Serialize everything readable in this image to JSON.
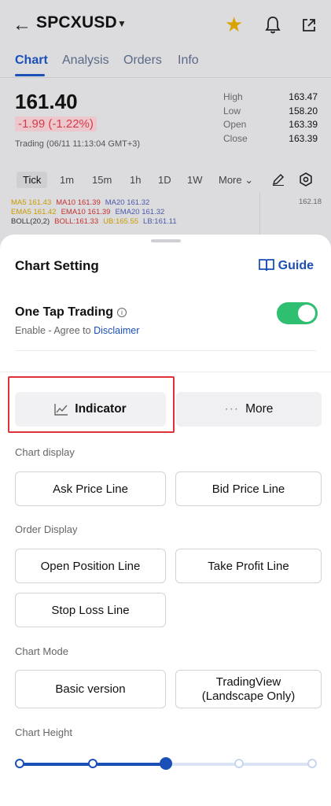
{
  "header": {
    "symbol": "SPCXUSD",
    "back_icon": "arrow-left-icon",
    "favorite_icon": "star-icon",
    "favorite_color": "#d9a400",
    "notification_icon": "bell-icon",
    "share_icon": "share-icon"
  },
  "tabs": [
    {
      "label": "Chart",
      "active": true
    },
    {
      "label": "Analysis",
      "active": false
    },
    {
      "label": "Orders",
      "active": false
    },
    {
      "label": "Info",
      "active": false
    }
  ],
  "quote": {
    "price": "161.40",
    "change": "-1.99 (-1.22%)",
    "trading_status": "Trading (06/11 11:13:04 GMT+3)",
    "stats": [
      {
        "label": "High",
        "value": "163.47"
      },
      {
        "label": "Low",
        "value": "158.20"
      },
      {
        "label": "Open",
        "value": "163.39"
      },
      {
        "label": "Close",
        "value": "163.39"
      }
    ]
  },
  "timeframes": {
    "items": [
      "Tick",
      "1m",
      "15m",
      "1h",
      "1D",
      "1W"
    ],
    "selected": "Tick",
    "more_label": "More"
  },
  "indicators": {
    "ma5": "MA5 161.43",
    "ma10": "MA10 161.39",
    "ma20": "MA20 161.32",
    "ema5": "EMA5 161.42",
    "ema10": "EMA10 161.39",
    "ema20": "EMA20 161.32",
    "boll": "BOLL(20,2)",
    "boll_val": "BOLL:161.33",
    "ub": "UB:165.55",
    "lb": "LB:161.11",
    "axis_value": "162.18"
  },
  "sheet": {
    "title": "Chart Setting",
    "guide_label": "Guide",
    "one_tap": {
      "title": "One Tap Trading",
      "subtitle_prefix": "Enable - Agree to ",
      "disclaimer_link": "Disclaimer",
      "enabled": true
    },
    "segments": {
      "indicator": "Indicator",
      "more": "More",
      "selected": "Indicator"
    },
    "chart_display": {
      "title": "Chart display",
      "ask": "Ask Price Line",
      "bid": "Bid Price Line"
    },
    "order_display": {
      "title": "Order Display",
      "open_position": "Open Position Line",
      "take_profit": "Take Profit Line",
      "stop_loss": "Stop Loss Line"
    },
    "chart_mode": {
      "title": "Chart Mode",
      "basic": "Basic version",
      "tradingview_line1": "TradingView",
      "tradingview_line2": "(Landscape Only)"
    },
    "chart_height": {
      "title": "Chart Height",
      "steps": 5,
      "selected_step": 3
    }
  },
  "colors": {
    "accent": "#1b4fb8",
    "negative": "#d23b4c",
    "toggle_on": "#2fbf71",
    "highlight_box": "#e0313b"
  }
}
